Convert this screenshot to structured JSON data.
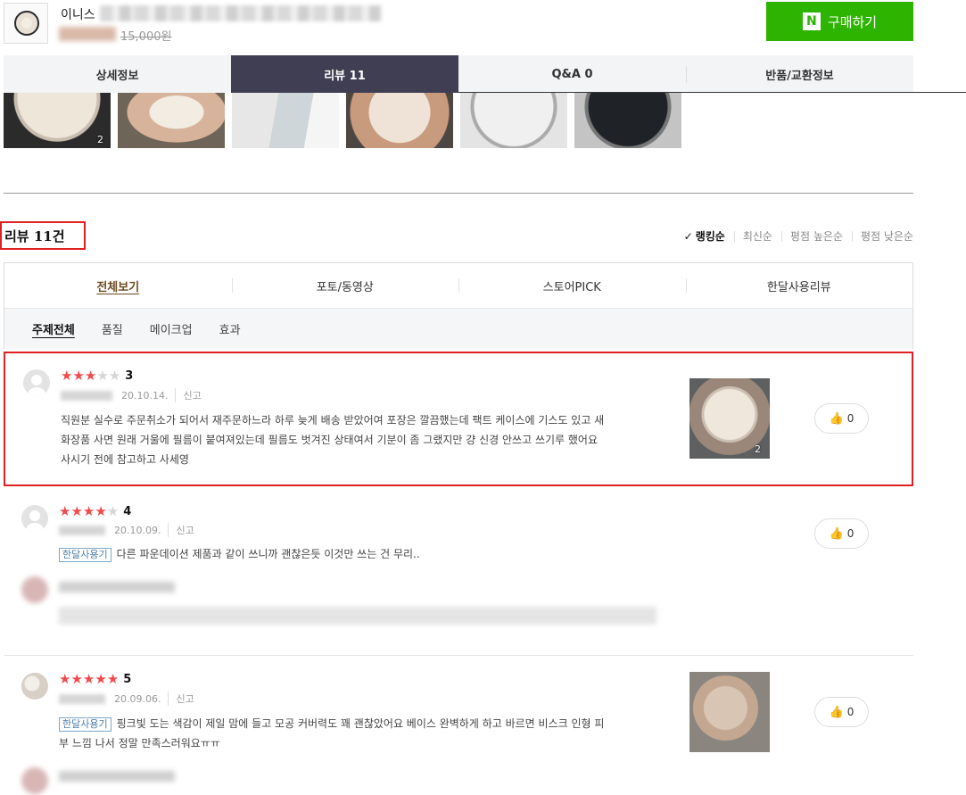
{
  "product": {
    "name_prefix": "이니스",
    "original_price": "15,000원",
    "buy_label": "구매하기",
    "buy_icon_letter": "N"
  },
  "tabs": [
    {
      "label": "상세정보",
      "active": false
    },
    {
      "label": "리뷰 11",
      "active": true
    },
    {
      "label": "Q&A 0",
      "active": false
    },
    {
      "label": "반품/교환정보",
      "active": false
    }
  ],
  "photo_strip": {
    "first_count": "2"
  },
  "reviews_header": {
    "title": "리뷰 11건",
    "sort_options": [
      "랭킹순",
      "최신순",
      "평점 높은순",
      "평점 낮은순"
    ],
    "active_sort": "랭킹순"
  },
  "filter_tabs": [
    "전체보기",
    "포토/동영상",
    "스토어PICK",
    "한달사용리뷰"
  ],
  "topic_tabs": [
    "주제전체",
    "품질",
    "메이크업",
    "효과"
  ],
  "reviews": [
    {
      "rating": 3,
      "score": "3",
      "date": "20.10.14.",
      "report": "신고",
      "lines": [
        "직원분 실수로 주문취소가 되어서 재주문하느라 하루 늦게 배송 받았어여 포장은 깔끔했는데 팩트 케이스에 기스도 있고 새",
        "화장품 사면 원래 거울에 필름이 붙여져있는데 필름도 벗겨진 상태여서 기분이 좀 그랬지만 걍 신경 안쓰고 쓰기루 했어요",
        "사시기 전에 참고하고 사세영"
      ],
      "photo_count": "2",
      "likes": "0"
    },
    {
      "rating": 4,
      "score": "4",
      "date": "20.10.09.",
      "report": "신고",
      "badge": "한달사용기",
      "lines": [
        "다른 파운데이션 제품과 같이 쓰니까 괜찮은듯 이것만 쓰는 건 무리.."
      ],
      "likes": "0"
    },
    {
      "rating": 5,
      "score": "5",
      "date": "20.09.06.",
      "report": "신고",
      "badge": "한달사용기",
      "lines": [
        "핑크빛 도는 색감이 제일 맘에 들고 모공 커버력도 꽤 괜찮았어요 베이스 완벽하게 하고 바르면 비스크 인형 피",
        "부 느낌 나서 정말 만족스러워요ㅠㅠ"
      ],
      "likes": "0"
    }
  ],
  "colors": {
    "buy_green": "#2db400",
    "active_tab": "#3f3e52",
    "star_red": "#f04a4a",
    "highlight_red": "#e02020"
  }
}
